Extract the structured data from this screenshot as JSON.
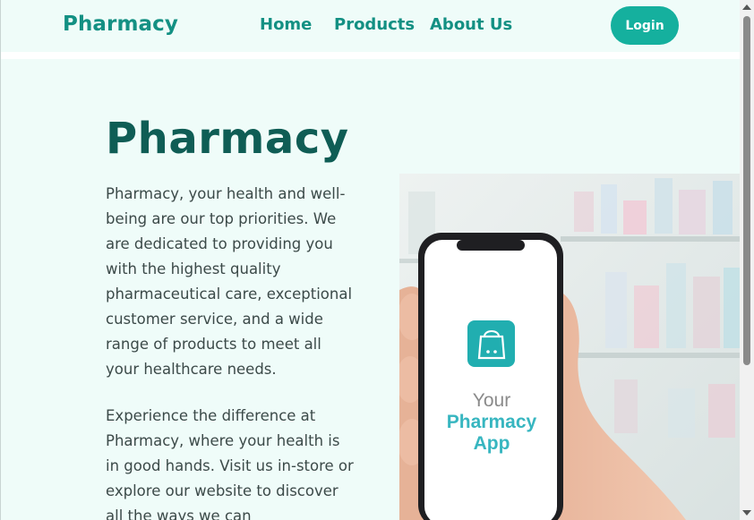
{
  "nav": {
    "brand": "Pharmacy",
    "links": [
      "Home",
      "Products",
      "About Us"
    ],
    "login_label": "Login"
  },
  "hero": {
    "title": "Pharmacy",
    "paragraph1": "Pharmacy, your health and well-being are our top priorities. We are dedicated to providing you with the highest quality pharmaceutical care, exceptional customer service, and a wide range of products to meet all your healthcare needs.",
    "paragraph2": "Experience the difference at Pharmacy, where your health is in good hands. Visit us in-store or explore our website to discover all the ways we can",
    "image": {
      "app_line1": "Your",
      "app_line2": "Pharmacy",
      "app_line3": "App",
      "icon": "shopping-bag-icon"
    }
  },
  "colors": {
    "brand": "#139083",
    "title": "#0f5d55",
    "button": "#15b09e",
    "background": "#effcf9"
  }
}
